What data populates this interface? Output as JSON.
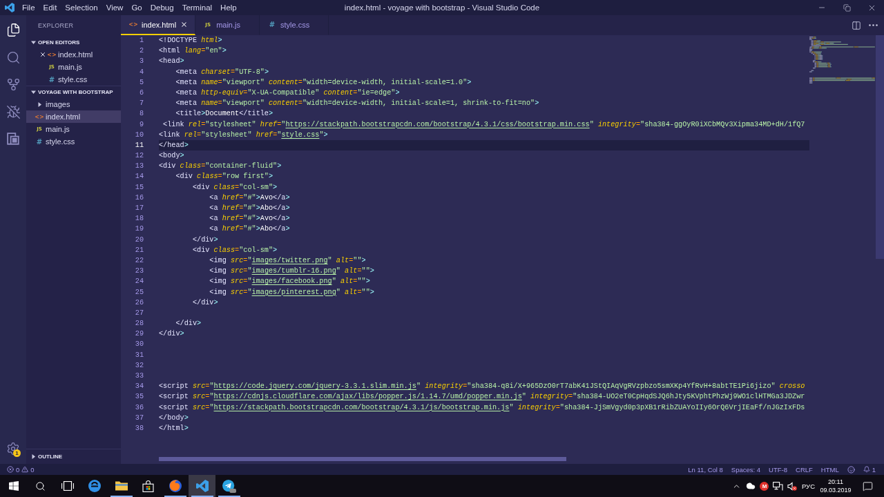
{
  "title_bar": {
    "menu": [
      "File",
      "Edit",
      "Selection",
      "View",
      "Go",
      "Debug",
      "Terminal",
      "Help"
    ],
    "title": "index.html - voyage with bootstrap - Visual Studio Code"
  },
  "activity_bar": {
    "items": [
      {
        "kind": "explorer",
        "selected": true
      },
      {
        "kind": "search",
        "selected": false
      },
      {
        "kind": "scm",
        "selected": false
      },
      {
        "kind": "debug",
        "selected": false
      },
      {
        "kind": "extensions",
        "selected": false
      }
    ],
    "settings_badge": "1"
  },
  "sidebar": {
    "title": "EXPLORER",
    "sections": [
      {
        "kind": "editors",
        "title": "OPEN EDITORS",
        "expanded": true,
        "items": [
          {
            "name": "index.html",
            "kind": "html",
            "glyph": "<>",
            "show_close": true,
            "selected": false
          },
          {
            "name": "main.js",
            "kind": "js",
            "glyph": "JS",
            "show_close": false,
            "selected": false
          },
          {
            "name": "style.css",
            "kind": "css",
            "glyph": "#",
            "show_close": false,
            "selected": false
          }
        ]
      },
      {
        "kind": "folder",
        "title": "VOYAGE WITH BOOTSTRAP",
        "expanded": true,
        "items": [
          {
            "name": "images",
            "kind": "folder",
            "expanded": false,
            "selected": false
          },
          {
            "name": "index.html",
            "kind": "html",
            "glyph": "<>",
            "selected": true
          },
          {
            "name": "main.js",
            "kind": "js",
            "glyph": "JS",
            "selected": false
          },
          {
            "name": "style.css",
            "kind": "css",
            "glyph": "#",
            "selected": false
          }
        ]
      }
    ],
    "outline": {
      "title": "OUTLINE",
      "expanded": false
    }
  },
  "tabs": [
    {
      "label": "index.html",
      "kind": "html",
      "glyph": "<>",
      "selected": true
    },
    {
      "label": "main.js",
      "kind": "js",
      "glyph": "JS",
      "selected": false
    },
    {
      "label": "style.css",
      "kind": "css",
      "glyph": "#",
      "selected": false
    }
  ],
  "editor": {
    "lines": [
      {
        "number": "1",
        "current": false,
        "tokens": [
          {
            "kind": "tag",
            "text": "<!DOCTYPE"
          },
          {
            "kind": "attr",
            "text": " html"
          },
          {
            "kind": "punct",
            "text": ">"
          }
        ]
      },
      {
        "number": "2",
        "current": false,
        "tokens": [
          {
            "kind": "tag",
            "text": "<html"
          },
          {
            "kind": "attr",
            "text": " lang"
          },
          {
            "kind": "eq",
            "text": "="
          },
          {
            "kind": "string",
            "text": "\"en\""
          },
          {
            "kind": "punct",
            "text": ">"
          }
        ]
      },
      {
        "number": "3",
        "current": false,
        "tokens": [
          {
            "kind": "tag",
            "text": "<head"
          },
          {
            "kind": "punct",
            "text": ">"
          }
        ]
      },
      {
        "number": "4",
        "current": false,
        "tokens": [
          {
            "kind": "tag",
            "text": "    <meta"
          },
          {
            "kind": "attr",
            "text": " charset"
          },
          {
            "kind": "eq",
            "text": "="
          },
          {
            "kind": "string",
            "text": "\"UTF-8\""
          },
          {
            "kind": "punct",
            "text": ">"
          }
        ]
      },
      {
        "number": "5",
        "current": false,
        "tokens": [
          {
            "kind": "tag",
            "text": "    <meta"
          },
          {
            "kind": "attr",
            "text": " name"
          },
          {
            "kind": "eq",
            "text": "="
          },
          {
            "kind": "string",
            "text": "\"viewport\""
          },
          {
            "kind": "attr",
            "text": " content"
          },
          {
            "kind": "eq",
            "text": "="
          },
          {
            "kind": "string",
            "text": "\"width=device-width, initial-scale=1.0\""
          },
          {
            "kind": "punct",
            "text": ">"
          }
        ]
      },
      {
        "number": "6",
        "current": false,
        "tokens": [
          {
            "kind": "tag",
            "text": "    <meta"
          },
          {
            "kind": "attr",
            "text": " http-equiv"
          },
          {
            "kind": "eq",
            "text": "="
          },
          {
            "kind": "string",
            "text": "\"X-UA-Compatible\""
          },
          {
            "kind": "attr",
            "text": " content"
          },
          {
            "kind": "eq",
            "text": "="
          },
          {
            "kind": "string",
            "text": "\"ie=edge\""
          },
          {
            "kind": "punct",
            "text": ">"
          }
        ]
      },
      {
        "number": "7",
        "current": false,
        "tokens": [
          {
            "kind": "tag",
            "text": "    <meta"
          },
          {
            "kind": "attr",
            "text": " name"
          },
          {
            "kind": "eq",
            "text": "="
          },
          {
            "kind": "string",
            "text": "\"viewport\""
          },
          {
            "kind": "attr",
            "text": " content"
          },
          {
            "kind": "eq",
            "text": "="
          },
          {
            "kind": "string",
            "text": "\"width=device-width, initial-scale=1, shrink-to-fit=no\""
          },
          {
            "kind": "punct",
            "text": ">"
          }
        ]
      },
      {
        "number": "8",
        "current": false,
        "tokens": [
          {
            "kind": "tag",
            "text": "    <title"
          },
          {
            "kind": "punct",
            "text": ">"
          },
          {
            "kind": "text",
            "text": "Document"
          },
          {
            "kind": "tag",
            "text": "</title"
          },
          {
            "kind": "punct",
            "text": ">"
          }
        ]
      },
      {
        "number": "9",
        "current": false,
        "tokens": [
          {
            "kind": "tag",
            "text": " <link"
          },
          {
            "kind": "attr",
            "text": " rel"
          },
          {
            "kind": "eq",
            "text": "="
          },
          {
            "kind": "string",
            "text": "\"stylesheet\""
          },
          {
            "kind": "attr",
            "text": " href"
          },
          {
            "kind": "eq",
            "text": "="
          },
          {
            "kind": "string",
            "text": "\""
          },
          {
            "kind": "link",
            "text": "https://stackpath.bootstrapcdn.com/bootstrap/4.3.1/css/bootstrap.min.css"
          },
          {
            "kind": "string",
            "text": "\""
          },
          {
            "kind": "attr",
            "text": " integrity"
          },
          {
            "kind": "eq",
            "text": "="
          },
          {
            "kind": "string",
            "text": "\"sha384-ggOyR0iXCbMQv3Xipma34MD+dH/1fQ7"
          }
        ]
      },
      {
        "number": "10",
        "current": false,
        "tokens": [
          {
            "kind": "tag",
            "text": "<link"
          },
          {
            "kind": "attr",
            "text": " rel"
          },
          {
            "kind": "eq",
            "text": "="
          },
          {
            "kind": "string",
            "text": "\"stylesheet\""
          },
          {
            "kind": "attr",
            "text": " href"
          },
          {
            "kind": "eq",
            "text": "="
          },
          {
            "kind": "string",
            "text": "\""
          },
          {
            "kind": "link",
            "text": "style.css"
          },
          {
            "kind": "string",
            "text": "\""
          },
          {
            "kind": "punct",
            "text": ">"
          }
        ]
      },
      {
        "number": "11",
        "current": true,
        "tokens": [
          {
            "kind": "tag",
            "text": "</head"
          },
          {
            "kind": "punct",
            "text": ">"
          }
        ]
      },
      {
        "number": "12",
        "current": false,
        "tokens": [
          {
            "kind": "tag",
            "text": "<body"
          },
          {
            "kind": "punct",
            "text": ">"
          }
        ]
      },
      {
        "number": "13",
        "current": false,
        "tokens": [
          {
            "kind": "tag",
            "text": "<div"
          },
          {
            "kind": "attr",
            "text": " class"
          },
          {
            "kind": "eq",
            "text": "="
          },
          {
            "kind": "string",
            "text": "\"container-fluid\""
          },
          {
            "kind": "punct",
            "text": ">"
          }
        ]
      },
      {
        "number": "14",
        "current": false,
        "tokens": [
          {
            "kind": "tag",
            "text": "    <div"
          },
          {
            "kind": "attr",
            "text": " class"
          },
          {
            "kind": "eq",
            "text": "="
          },
          {
            "kind": "string",
            "text": "\"row first\""
          },
          {
            "kind": "punct",
            "text": ">"
          }
        ]
      },
      {
        "number": "15",
        "current": false,
        "tokens": [
          {
            "kind": "tag",
            "text": "        <div"
          },
          {
            "kind": "attr",
            "text": " class"
          },
          {
            "kind": "eq",
            "text": "="
          },
          {
            "kind": "string",
            "text": "\"col-sm\""
          },
          {
            "kind": "punct",
            "text": ">"
          }
        ]
      },
      {
        "number": "16",
        "current": false,
        "tokens": [
          {
            "kind": "tag",
            "text": "            <a"
          },
          {
            "kind": "attr",
            "text": " href"
          },
          {
            "kind": "eq",
            "text": "="
          },
          {
            "kind": "string",
            "text": "\"#\""
          },
          {
            "kind": "punct",
            "text": ">"
          },
          {
            "kind": "text",
            "text": "Avo"
          },
          {
            "kind": "tag",
            "text": "</a"
          },
          {
            "kind": "punct",
            "text": ">"
          }
        ]
      },
      {
        "number": "17",
        "current": false,
        "tokens": [
          {
            "kind": "tag",
            "text": "            <a"
          },
          {
            "kind": "attr",
            "text": " href"
          },
          {
            "kind": "eq",
            "text": "="
          },
          {
            "kind": "string",
            "text": "\"#\""
          },
          {
            "kind": "punct",
            "text": ">"
          },
          {
            "kind": "text",
            "text": "Abo"
          },
          {
            "kind": "tag",
            "text": "</a"
          },
          {
            "kind": "punct",
            "text": ">"
          }
        ]
      },
      {
        "number": "18",
        "current": false,
        "tokens": [
          {
            "kind": "tag",
            "text": "            <a"
          },
          {
            "kind": "attr",
            "text": " href"
          },
          {
            "kind": "eq",
            "text": "="
          },
          {
            "kind": "string",
            "text": "\"#\""
          },
          {
            "kind": "punct",
            "text": ">"
          },
          {
            "kind": "text",
            "text": "Avo"
          },
          {
            "kind": "tag",
            "text": "</a"
          },
          {
            "kind": "punct",
            "text": ">"
          }
        ]
      },
      {
        "number": "19",
        "current": false,
        "tokens": [
          {
            "kind": "tag",
            "text": "            <a"
          },
          {
            "kind": "attr",
            "text": " href"
          },
          {
            "kind": "eq",
            "text": "="
          },
          {
            "kind": "string",
            "text": "\"#\""
          },
          {
            "kind": "punct",
            "text": ">"
          },
          {
            "kind": "text",
            "text": "Abo"
          },
          {
            "kind": "tag",
            "text": "</a"
          },
          {
            "kind": "punct",
            "text": ">"
          }
        ]
      },
      {
        "number": "20",
        "current": false,
        "tokens": [
          {
            "kind": "tag",
            "text": "        </div"
          },
          {
            "kind": "punct",
            "text": ">"
          }
        ]
      },
      {
        "number": "21",
        "current": false,
        "tokens": [
          {
            "kind": "tag",
            "text": "        <div"
          },
          {
            "kind": "attr",
            "text": " class"
          },
          {
            "kind": "eq",
            "text": "="
          },
          {
            "kind": "string",
            "text": "\"col-sm\""
          },
          {
            "kind": "punct",
            "text": ">"
          }
        ]
      },
      {
        "number": "22",
        "current": false,
        "tokens": [
          {
            "kind": "tag",
            "text": "            <img"
          },
          {
            "kind": "attr",
            "text": " src"
          },
          {
            "kind": "eq",
            "text": "="
          },
          {
            "kind": "string",
            "text": "\""
          },
          {
            "kind": "link",
            "text": "images/twitter.png"
          },
          {
            "kind": "string",
            "text": "\""
          },
          {
            "kind": "attr",
            "text": " alt"
          },
          {
            "kind": "eq",
            "text": "="
          },
          {
            "kind": "string",
            "text": "\"\""
          },
          {
            "kind": "punct",
            "text": ">"
          }
        ]
      },
      {
        "number": "23",
        "current": false,
        "tokens": [
          {
            "kind": "tag",
            "text": "            <img"
          },
          {
            "kind": "attr",
            "text": " src"
          },
          {
            "kind": "eq",
            "text": "="
          },
          {
            "kind": "string",
            "text": "\""
          },
          {
            "kind": "link",
            "text": "images/tumblr-16.png"
          },
          {
            "kind": "string",
            "text": "\""
          },
          {
            "kind": "attr",
            "text": " alt"
          },
          {
            "kind": "eq",
            "text": "="
          },
          {
            "kind": "string",
            "text": "\"\""
          },
          {
            "kind": "punct",
            "text": ">"
          }
        ]
      },
      {
        "number": "24",
        "current": false,
        "tokens": [
          {
            "kind": "tag",
            "text": "            <img"
          },
          {
            "kind": "attr",
            "text": " src"
          },
          {
            "kind": "eq",
            "text": "="
          },
          {
            "kind": "string",
            "text": "\""
          },
          {
            "kind": "link",
            "text": "images/facebook.png"
          },
          {
            "kind": "string",
            "text": "\""
          },
          {
            "kind": "attr",
            "text": " alt"
          },
          {
            "kind": "eq",
            "text": "="
          },
          {
            "kind": "string",
            "text": "\"\""
          },
          {
            "kind": "punct",
            "text": ">"
          }
        ]
      },
      {
        "number": "25",
        "current": false,
        "tokens": [
          {
            "kind": "tag",
            "text": "            <img"
          },
          {
            "kind": "attr",
            "text": " src"
          },
          {
            "kind": "eq",
            "text": "="
          },
          {
            "kind": "string",
            "text": "\""
          },
          {
            "kind": "link",
            "text": "images/pinterest.png"
          },
          {
            "kind": "string",
            "text": "\""
          },
          {
            "kind": "attr",
            "text": " alt"
          },
          {
            "kind": "eq",
            "text": "="
          },
          {
            "kind": "string",
            "text": "\"\""
          },
          {
            "kind": "punct",
            "text": ">"
          }
        ]
      },
      {
        "number": "26",
        "current": false,
        "tokens": [
          {
            "kind": "tag",
            "text": "        </div"
          },
          {
            "kind": "punct",
            "text": ">"
          }
        ]
      },
      {
        "number": "27",
        "current": false
      },
      {
        "number": "28",
        "current": false,
        "tokens": [
          {
            "kind": "tag",
            "text": "    </div"
          },
          {
            "kind": "punct",
            "text": ">"
          }
        ]
      },
      {
        "number": "29",
        "current": false,
        "tokens": [
          {
            "kind": "tag",
            "text": "</div"
          },
          {
            "kind": "punct",
            "text": ">"
          }
        ]
      },
      {
        "number": "30",
        "current": false
      },
      {
        "number": "31",
        "current": false
      },
      {
        "number": "32",
        "current": false
      },
      {
        "number": "33",
        "current": false
      },
      {
        "number": "34",
        "current": false,
        "tokens": [
          {
            "kind": "tag",
            "text": "<script"
          },
          {
            "kind": "attr",
            "text": " src"
          },
          {
            "kind": "eq",
            "text": "="
          },
          {
            "kind": "string",
            "text": "\""
          },
          {
            "kind": "link",
            "text": "https://code.jquery.com/jquery-3.3.1.slim.min.js"
          },
          {
            "kind": "string",
            "text": "\""
          },
          {
            "kind": "attr",
            "text": " integrity"
          },
          {
            "kind": "eq",
            "text": "="
          },
          {
            "kind": "string",
            "text": "\"sha384-q8i/X+965DzO0rT7abK41JStQIAqVgRVzpbzo5smXKp4YfRvH+8abtTE1Pi6jizo\""
          },
          {
            "kind": "attr",
            "text": " crosso"
          }
        ]
      },
      {
        "number": "35",
        "current": false,
        "tokens": [
          {
            "kind": "tag",
            "text": "<script"
          },
          {
            "kind": "attr",
            "text": " src"
          },
          {
            "kind": "eq",
            "text": "="
          },
          {
            "kind": "string",
            "text": "\""
          },
          {
            "kind": "link",
            "text": "https://cdnjs.cloudflare.com/ajax/libs/popper.js/1.14.7/umd/popper.min.js"
          },
          {
            "kind": "string",
            "text": "\""
          },
          {
            "kind": "attr",
            "text": " integrity"
          },
          {
            "kind": "eq",
            "text": "="
          },
          {
            "kind": "string",
            "text": "\"sha384-UO2eT0CpHqdSJQ6hJty5KVphtPhzWj9WO1clHTMGa3JDZwr"
          }
        ]
      },
      {
        "number": "36",
        "current": false,
        "tokens": [
          {
            "kind": "tag",
            "text": "<script"
          },
          {
            "kind": "attr",
            "text": " src"
          },
          {
            "kind": "eq",
            "text": "="
          },
          {
            "kind": "string",
            "text": "\""
          },
          {
            "kind": "link",
            "text": "https://stackpath.bootstrapcdn.com/bootstrap/4.3.1/js/bootstrap.min.js"
          },
          {
            "kind": "string",
            "text": "\""
          },
          {
            "kind": "attr",
            "text": " integrity"
          },
          {
            "kind": "eq",
            "text": "="
          },
          {
            "kind": "string",
            "text": "\"sha384-JjSmVgyd0p3pXB1rRibZUAYoIIy6OrQ6VrjIEaFf/nJGzIxFDs"
          }
        ]
      },
      {
        "number": "37",
        "current": false,
        "tokens": [
          {
            "kind": "tag",
            "text": "</body"
          },
          {
            "kind": "punct",
            "text": ">"
          }
        ]
      },
      {
        "number": "38",
        "current": false,
        "tokens": [
          {
            "kind": "tag",
            "text": "</html"
          },
          {
            "kind": "punct",
            "text": ">"
          }
        ]
      }
    ]
  },
  "status_bar": {
    "errors": "0",
    "warnings": "0",
    "items": [
      "Ln 11, Col 8",
      "Spaces: 4",
      "UTF-8",
      "CRLF",
      "HTML"
    ],
    "notifications": "1"
  },
  "taskbar": {
    "apps": [
      {
        "kind": "edge",
        "running": false,
        "selected": false
      },
      {
        "kind": "explorer",
        "running": true,
        "selected": false
      },
      {
        "kind": "store",
        "running": false,
        "selected": false
      },
      {
        "kind": "firefox",
        "running": true,
        "selected": false
      },
      {
        "kind": "code",
        "running": true,
        "selected": true
      },
      {
        "kind": "telegram",
        "running": true,
        "selected": false
      }
    ],
    "tray": {
      "app_letter": "M",
      "language": "РУС",
      "time": "20:11",
      "date": "09.03.2019"
    }
  }
}
